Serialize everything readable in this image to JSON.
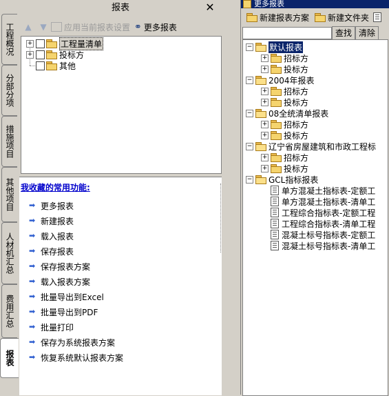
{
  "vertical_tabs": [
    {
      "label": "工程概况",
      "active": false
    },
    {
      "label": "分部分项",
      "active": false
    },
    {
      "label": "措施项目",
      "active": false
    },
    {
      "label": "其他项目",
      "active": false
    },
    {
      "label": "人材机汇总",
      "active": false
    },
    {
      "label": "费用汇总",
      "active": false
    },
    {
      "label": "报表",
      "active": true
    }
  ],
  "left_panel": {
    "title": "报表",
    "close_symbol": "✕",
    "toolbar": {
      "apply_label": "应用当前报表设置",
      "more_label": "更多报表"
    },
    "tree": [
      {
        "label": "工程量清单"
      },
      {
        "label": "投标方"
      },
      {
        "label": "其他"
      }
    ],
    "favorites": {
      "title": "我收藏的常用功能:",
      "items": [
        "更多报表",
        "新建报表",
        "载入报表",
        "保存报表",
        "保存报表方案",
        "载入报表方案",
        "批量导出到Excel",
        "批量导出到PDF",
        "批量打印",
        "保存为系统报表方案",
        "恢复系统默认报表方案"
      ]
    }
  },
  "right_panel": {
    "title": "更多报表",
    "toolbar": {
      "new_scheme": "新建报表方案",
      "new_folder": "新建文件夹"
    },
    "search": {
      "value": "",
      "find_label": "查找",
      "clear_label": "清除"
    },
    "tree": [
      {
        "label": "默认报表",
        "children": [
          "招标方",
          "投标方"
        ]
      },
      {
        "label": "2004年报表",
        "children": [
          "招标方",
          "投标方"
        ]
      },
      {
        "label": "08全统清单报表",
        "children": [
          "招标方",
          "投标方"
        ]
      },
      {
        "label": "辽宁省房屋建筑和市政工程标",
        "children": [
          "招标方",
          "投标方"
        ]
      },
      {
        "label": "GCL指标报表",
        "docs": [
          "单方混凝土指标表-定额工",
          "单方混凝土指标表-清单工",
          "工程综合指标表-定额工程",
          "工程综合指标表-清单工程",
          "混凝土标号指标表-定额工",
          "混凝土标号指标表-清单工"
        ]
      }
    ]
  }
}
